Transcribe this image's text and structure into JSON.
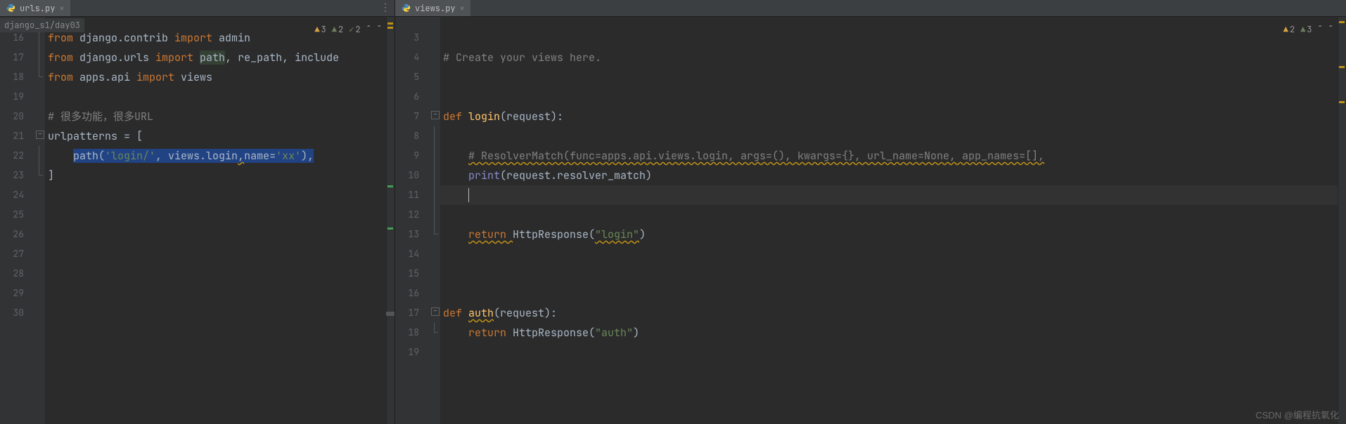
{
  "left": {
    "tab": {
      "filename": "urls.py"
    },
    "breadcrumb": "django_s1/day03",
    "status": {
      "warn1": "3",
      "warn2": "2",
      "check": "2"
    },
    "lines": [
      {
        "n": 16,
        "segs": [
          {
            "t": "from ",
            "c": "kw"
          },
          {
            "t": "django.contrib ",
            "c": ""
          },
          {
            "t": "import ",
            "c": "kw"
          },
          {
            "t": "admin",
            "c": ""
          }
        ]
      },
      {
        "n": 17,
        "segs": [
          {
            "t": "from ",
            "c": "kw"
          },
          {
            "t": "django.urls ",
            "c": ""
          },
          {
            "t": "import ",
            "c": "kw"
          },
          {
            "t": "path",
            "c": "hl-name"
          },
          {
            "t": ", ",
            "c": ""
          },
          {
            "t": "re_path",
            "c": ""
          },
          {
            "t": ", ",
            "c": ""
          },
          {
            "t": "include",
            "c": ""
          }
        ]
      },
      {
        "n": 18,
        "segs": [
          {
            "t": "from ",
            "c": "kw"
          },
          {
            "t": "apps.api ",
            "c": ""
          },
          {
            "t": "import ",
            "c": "kw"
          },
          {
            "t": "views",
            "c": ""
          }
        ]
      },
      {
        "n": 19,
        "segs": []
      },
      {
        "n": 20,
        "segs": [
          {
            "t": "# 很多功能，很多URL",
            "c": "cmt"
          }
        ]
      },
      {
        "n": 21,
        "segs": [
          {
            "t": "urlpatterns = [",
            "c": ""
          }
        ]
      },
      {
        "n": 22,
        "segs": [
          {
            "t": "    ",
            "c": ""
          },
          {
            "t": "path(",
            "c": "sel"
          },
          {
            "t": "'login/'",
            "c": "sel str"
          },
          {
            "t": ", views.login",
            "c": "sel"
          },
          {
            "t": ",",
            "c": "sel warn-u"
          },
          {
            "t": "name",
            "c": "sel"
          },
          {
            "t": "=",
            "c": "sel"
          },
          {
            "t": "'xx'",
            "c": "sel str"
          },
          {
            "t": ")",
            "c": "sel"
          },
          {
            "t": ",",
            "c": "sel"
          }
        ]
      },
      {
        "n": 23,
        "segs": [
          {
            "t": "]",
            "c": ""
          }
        ]
      },
      {
        "n": 24,
        "segs": []
      },
      {
        "n": 25,
        "segs": []
      },
      {
        "n": 26,
        "segs": []
      },
      {
        "n": 27,
        "segs": []
      },
      {
        "n": 28,
        "segs": []
      },
      {
        "n": 29,
        "segs": []
      },
      {
        "n": 30,
        "segs": []
      }
    ]
  },
  "right": {
    "tab": {
      "filename": "views.py"
    },
    "status": {
      "warn1": "2",
      "warn2": "3"
    },
    "lines": [
      {
        "n": 3,
        "segs": []
      },
      {
        "n": 4,
        "segs": [
          {
            "t": "# Create your views here.",
            "c": "cmt"
          }
        ]
      },
      {
        "n": 5,
        "segs": []
      },
      {
        "n": 6,
        "segs": []
      },
      {
        "n": 7,
        "segs": [
          {
            "t": "def ",
            "c": "kw"
          },
          {
            "t": "login",
            "c": "fn"
          },
          {
            "t": "(request):",
            "c": ""
          }
        ]
      },
      {
        "n": 8,
        "segs": []
      },
      {
        "n": 9,
        "segs": [
          {
            "t": "    ",
            "c": ""
          },
          {
            "t": "# ResolverMatch(func=apps.api.views.login, args=(), kwargs={}, url_name=None, app_names=[],",
            "c": "cmt warn-u"
          }
        ]
      },
      {
        "n": 10,
        "segs": [
          {
            "t": "    ",
            "c": ""
          },
          {
            "t": "print",
            "c": "builtin"
          },
          {
            "t": "(request.resolver_match)",
            "c": ""
          }
        ]
      },
      {
        "n": 11,
        "current": true,
        "segs": [
          {
            "t": "    ",
            "c": ""
          }
        ]
      },
      {
        "n": 12,
        "segs": []
      },
      {
        "n": 13,
        "segs": [
          {
            "t": "    ",
            "c": ""
          },
          {
            "t": "return ",
            "c": "kw warn-u"
          },
          {
            "t": "HttpResponse(",
            "c": ""
          },
          {
            "t": "\"login\"",
            "c": "str warn-u"
          },
          {
            "t": ")",
            "c": ""
          }
        ]
      },
      {
        "n": 14,
        "segs": []
      },
      {
        "n": 15,
        "segs": []
      },
      {
        "n": 16,
        "segs": []
      },
      {
        "n": 17,
        "segs": [
          {
            "t": "def ",
            "c": "kw"
          },
          {
            "t": "auth",
            "c": "fn warn-u"
          },
          {
            "t": "(request):",
            "c": ""
          }
        ]
      },
      {
        "n": 18,
        "segs": [
          {
            "t": "    ",
            "c": ""
          },
          {
            "t": "return ",
            "c": "kw"
          },
          {
            "t": "HttpResponse(",
            "c": ""
          },
          {
            "t": "\"auth\"",
            "c": "str"
          },
          {
            "t": ")",
            "c": ""
          }
        ]
      },
      {
        "n": 19,
        "segs": []
      }
    ]
  },
  "watermark": "CSDN @编程抗氧化"
}
